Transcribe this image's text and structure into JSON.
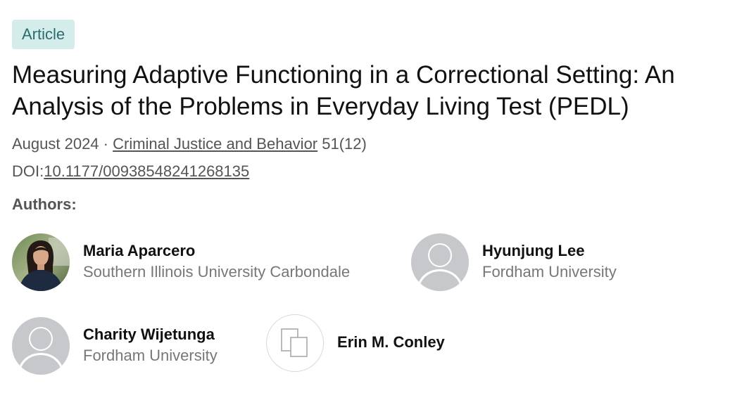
{
  "badge": {
    "label": "Article"
  },
  "title": "Measuring Adaptive Functioning in a Correctional Setting: An Analysis of the Problems in Everyday Living Test (PEDL)",
  "meta": {
    "date": "August 2024",
    "separator": " · ",
    "journal": "Criminal Justice and Behavior",
    "volume_issue": " 51(12)",
    "doi_prefix": "DOI:",
    "doi": "10.1177/00938548241268135"
  },
  "authors_heading": "Authors:",
  "authors": [
    {
      "name": "Maria Aparcero",
      "affiliation": "Southern Illinois University Carbondale",
      "avatar": "photo"
    },
    {
      "name": "Hyunjung Lee",
      "affiliation": "Fordham University",
      "avatar": "person-placeholder-icon"
    },
    {
      "name": "Charity Wijetunga",
      "affiliation": "Fordham University",
      "avatar": "person-placeholder-icon"
    },
    {
      "name": "Erin M. Conley",
      "affiliation": "",
      "avatar": "document-copy-icon"
    }
  ],
  "colors": {
    "badge_bg": "#d4ecea",
    "badge_text": "#2b6c6e",
    "placeholder_avatar": "#c6c8cb",
    "secondary_text": "#777777"
  }
}
